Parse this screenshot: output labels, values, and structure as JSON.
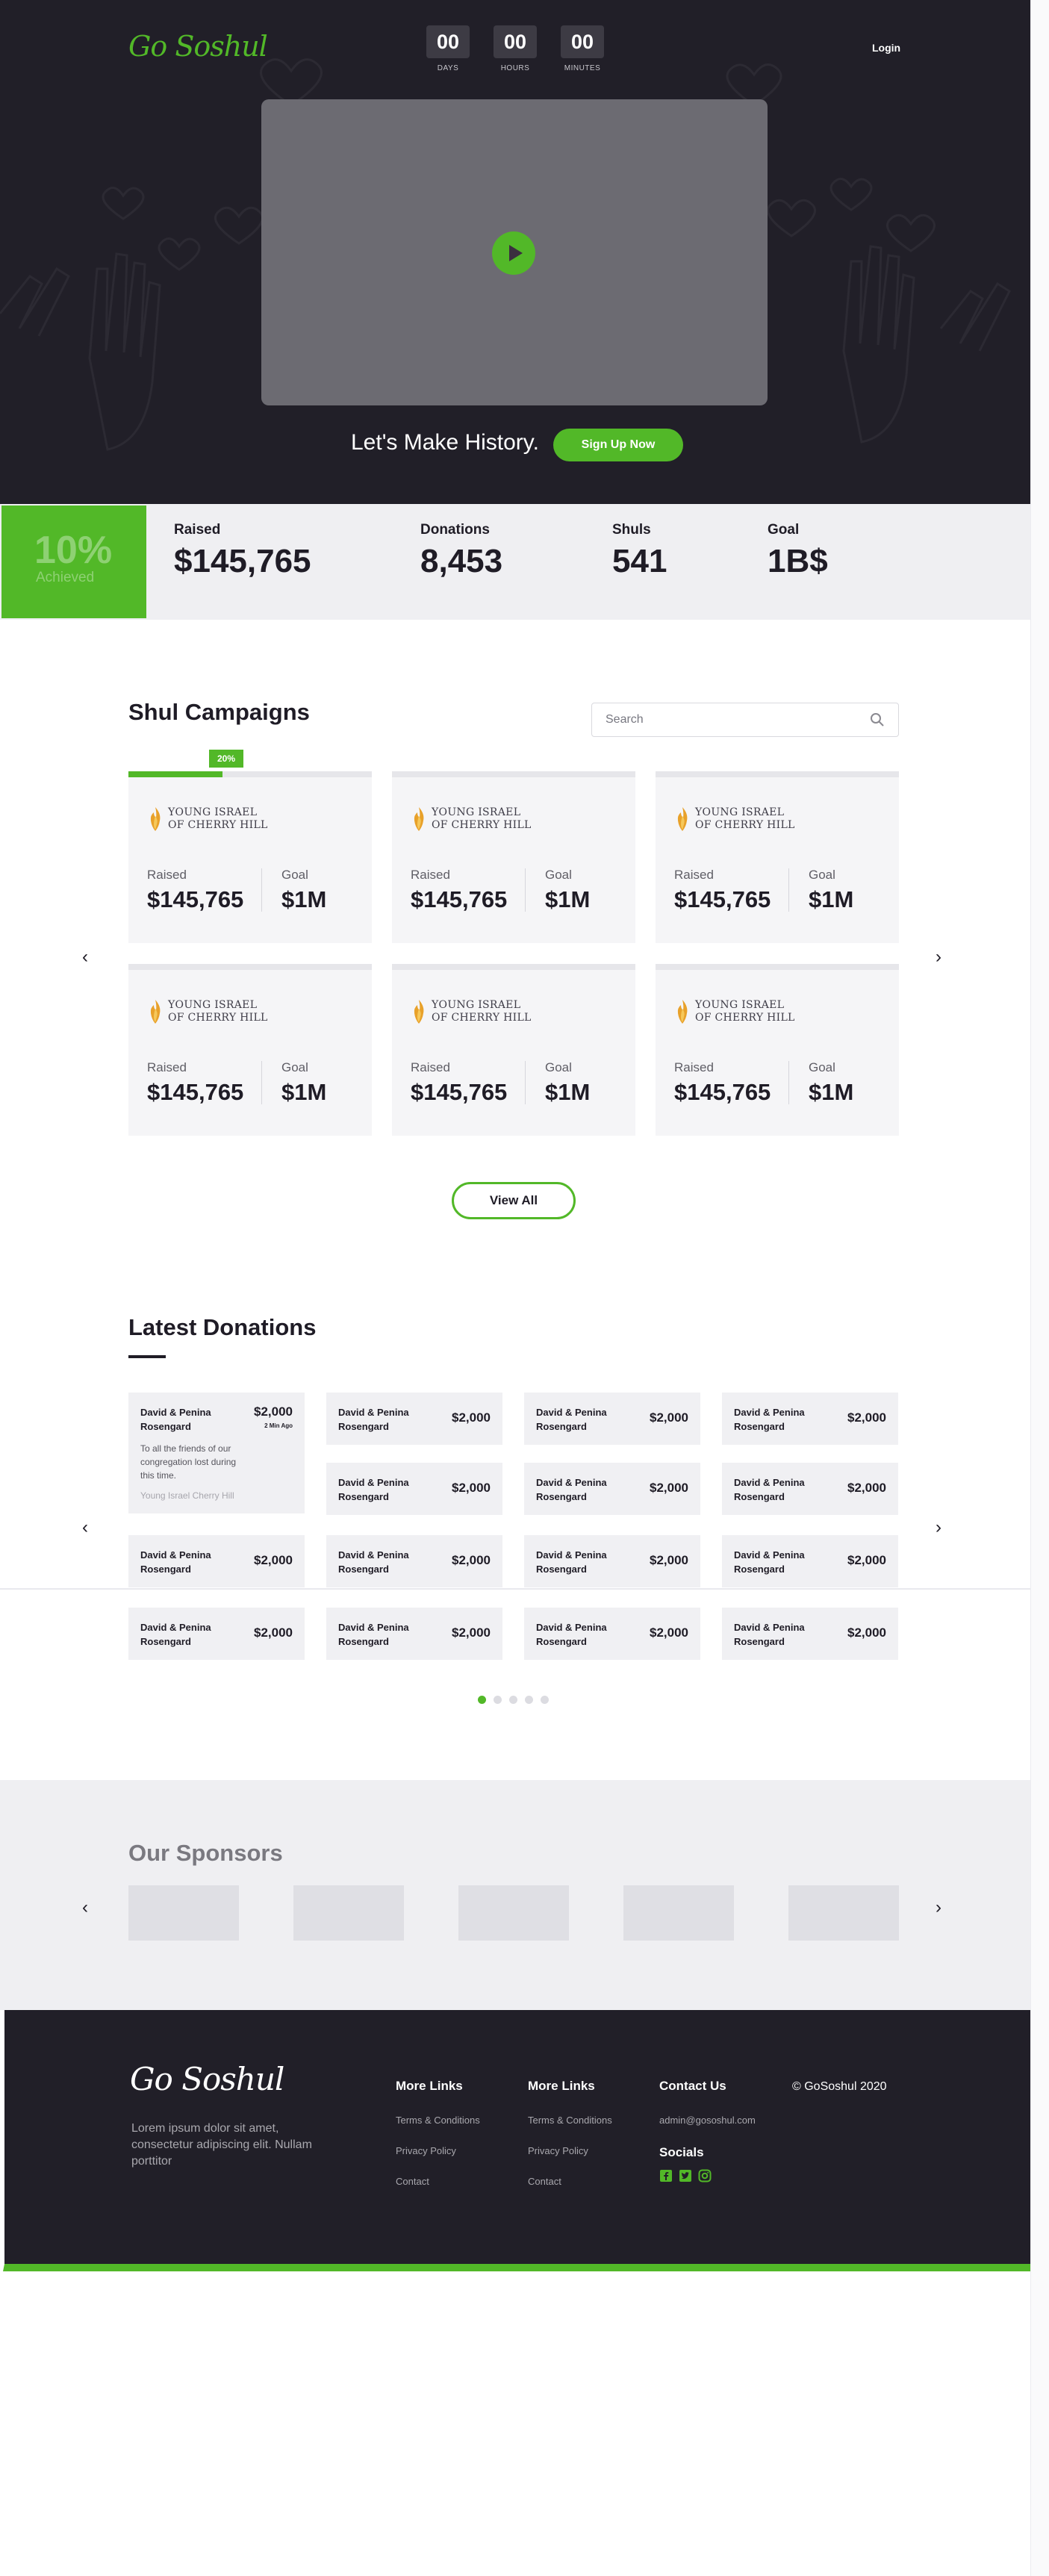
{
  "brand": {
    "logo_text": "Go Soshul",
    "accent": "#52b828",
    "dark": "#211f28"
  },
  "header": {
    "countdown": [
      {
        "value": "00",
        "label": "DAYS"
      },
      {
        "value": "00",
        "label": "HOURS"
      },
      {
        "value": "00",
        "label": "MINUTES"
      }
    ],
    "login_label": "Login"
  },
  "hero": {
    "tagline": "Let's Make History.",
    "signup_label": "Sign Up Now"
  },
  "stats": {
    "achieved_pct": "10%",
    "achieved_label": "Achieved",
    "items": [
      {
        "label": "Raised",
        "value": "$145,765"
      },
      {
        "label": "Donations",
        "value": "8,453"
      },
      {
        "label": "Shuls",
        "value": "541"
      },
      {
        "label": "Goal",
        "value": "1B$"
      }
    ]
  },
  "campaigns": {
    "title": "Shul Campaigns",
    "search_placeholder": "Search",
    "progress_badge": "20%",
    "progress_fraction": 0.2,
    "view_all_label": "View All",
    "cards": [
      {
        "org_line1": "YOUNG ISRAEL",
        "org_line2": "OF CHERRY HILL",
        "raised_label": "Raised",
        "raised": "$145,765",
        "goal_label": "Goal",
        "goal": "$1M"
      },
      {
        "org_line1": "YOUNG ISRAEL",
        "org_line2": "OF CHERRY HILL",
        "raised_label": "Raised",
        "raised": "$145,765",
        "goal_label": "Goal",
        "goal": "$1M"
      },
      {
        "org_line1": "YOUNG ISRAEL",
        "org_line2": "OF CHERRY HILL",
        "raised_label": "Raised",
        "raised": "$145,765",
        "goal_label": "Goal",
        "goal": "$1M"
      },
      {
        "org_line1": "YOUNG ISRAEL",
        "org_line2": "OF CHERRY HILL",
        "raised_label": "Raised",
        "raised": "$145,765",
        "goal_label": "Goal",
        "goal": "$1M"
      },
      {
        "org_line1": "YOUNG ISRAEL",
        "org_line2": "OF CHERRY HILL",
        "raised_label": "Raised",
        "raised": "$145,765",
        "goal_label": "Goal",
        "goal": "$1M"
      },
      {
        "org_line1": "YOUNG ISRAEL",
        "org_line2": "OF CHERRY HILL",
        "raised_label": "Raised",
        "raised": "$145,765",
        "goal_label": "Goal",
        "goal": "$1M"
      }
    ]
  },
  "donations": {
    "title": "Latest Donations",
    "featured": {
      "name": "David & Penina Rosengard",
      "amount": "$2,000",
      "time": "2 Min Ago",
      "message": "To all the friends of our congregation lost during this time.",
      "org": "Young Israel Cherry Hill"
    },
    "item": {
      "name": "David & Penina Rosengard",
      "amount": "$2,000"
    },
    "page_count": 5,
    "active_page": 1
  },
  "sponsors": {
    "title": "Our Sponsors",
    "count": 5
  },
  "footer": {
    "description": "Lorem ipsum dolor sit amet, consectetur adipiscing elit. Nullam porttitor",
    "col1": {
      "heading": "More Links",
      "links": [
        "Terms & Conditions",
        "Privacy Policy",
        "Contact"
      ]
    },
    "col2": {
      "heading": "More Links",
      "links": [
        "Terms & Conditions",
        "Privacy Policy",
        "Contact"
      ]
    },
    "contact": {
      "heading": "Contact Us",
      "email": "admin@gososhul.com",
      "socials_heading": "Socials",
      "socials": [
        "facebook-icon",
        "twitter-icon",
        "instagram-icon"
      ]
    },
    "copyright": "© GoSoshul 2020"
  }
}
